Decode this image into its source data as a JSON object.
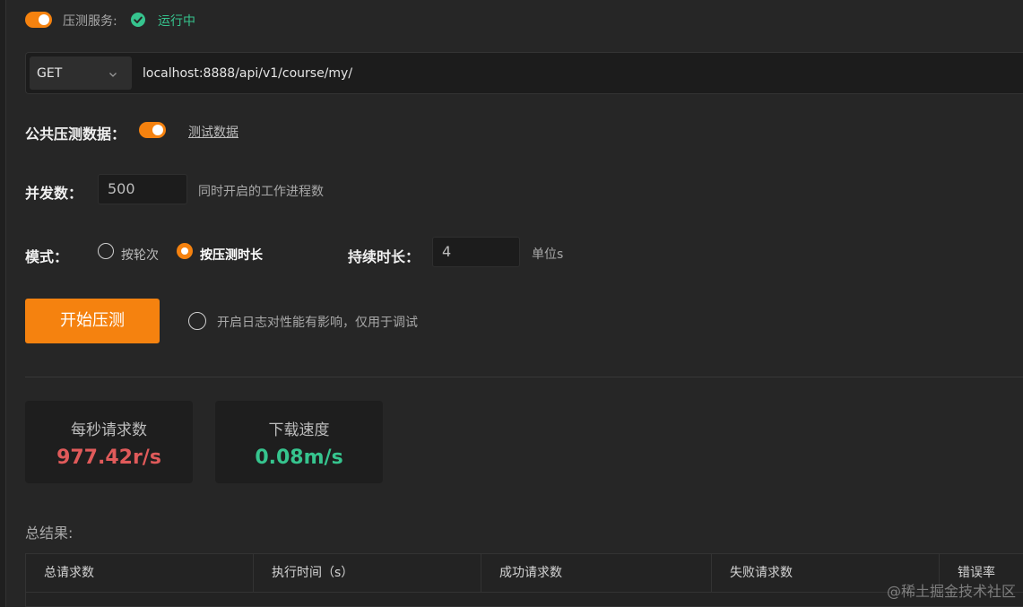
{
  "service": {
    "label": "压测服务:",
    "status": "运行中",
    "colors": {
      "toggle": "#f5820f",
      "status": "#36c48e"
    }
  },
  "request": {
    "method": "GET",
    "url": "localhost:8888/api/v1/course/my/"
  },
  "public_data": {
    "label": "公共压测数据：",
    "link": "测试数据",
    "enabled": true
  },
  "concurrency": {
    "label": "并发数：",
    "value": "500",
    "hint": "同时开启的工作进程数"
  },
  "mode": {
    "label": "模式：",
    "options": [
      "按轮次",
      "按压测时长"
    ],
    "selected": "按压测时长",
    "duration_label": "持续时长：",
    "duration_value": "4",
    "duration_unit": "单位s"
  },
  "start": {
    "button": "开始压测",
    "log_option": "开启日志对性能有影响，仅用于调试"
  },
  "stats": [
    {
      "title": "每秒请求数",
      "value": "977.42r/s",
      "color": "#e05a5a"
    },
    {
      "title": "下载速度",
      "value": "0.08m/s",
      "color": "#36c48e"
    }
  ],
  "results": {
    "title": "总结果:",
    "columns": [
      "总请求数",
      "执行时间（s）",
      "成功请求数",
      "失败请求数",
      "错误率"
    ]
  },
  "watermark": "@稀土掘金技术社区"
}
